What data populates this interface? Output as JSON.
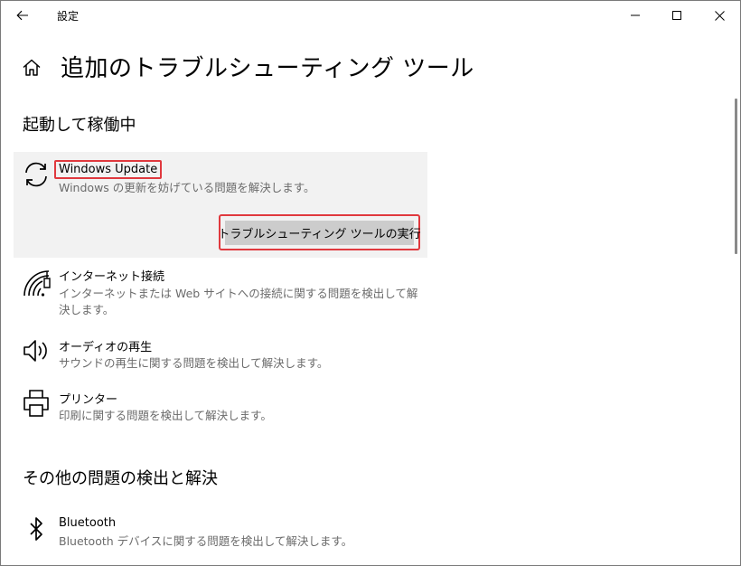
{
  "titlebar": {
    "title": "設定"
  },
  "header": {
    "page_title": "追加のトラブルシューティング ツール"
  },
  "sections": {
    "running": "起動して稼働中",
    "other": "その他の問題の検出と解決"
  },
  "items": {
    "windows_update": {
      "name": "Windows Update",
      "desc": "Windows の更新を妨げている問題を解決します。",
      "run_button": "トラブルシューティング ツールの実行",
      "icon": "sync-icon"
    },
    "internet": {
      "name": "インターネット接続",
      "desc": "インターネットまたは Web サイトへの接続に関する問題を検出して解決します。",
      "icon": "wifi-icon"
    },
    "audio": {
      "name": "オーディオの再生",
      "desc": "サウンドの再生に関する問題を検出して解決します。",
      "icon": "speaker-icon"
    },
    "printer": {
      "name": "プリンター",
      "desc": "印刷に関する問題を検出して解決します。",
      "icon": "printer-icon"
    },
    "bluetooth": {
      "name": "Bluetooth",
      "desc": "Bluetooth デバイスに関する問題を検出して解決します。",
      "icon": "bluetooth-icon"
    }
  },
  "colors": {
    "highlight_border": "#e0393e",
    "selected_bg": "#f2f2f2",
    "button_bg": "#cccccc",
    "secondary_text": "#6b6b6b"
  }
}
